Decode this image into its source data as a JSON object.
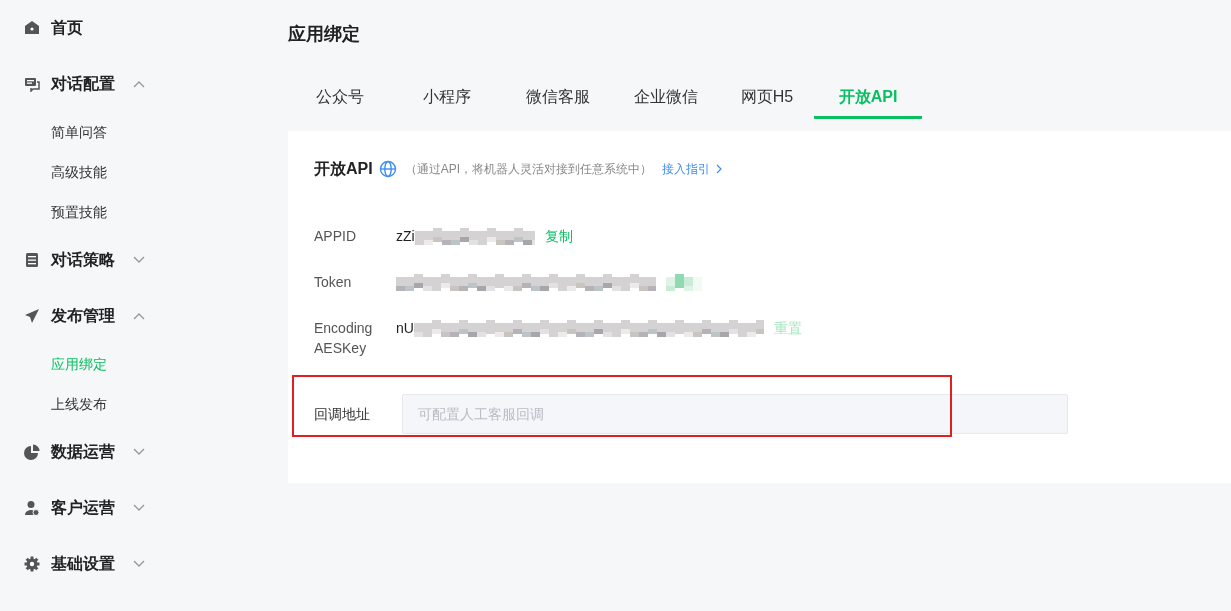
{
  "sidebar": {
    "items": [
      {
        "label": "首页"
      },
      {
        "label": "对话配置",
        "expanded": true,
        "children": [
          {
            "label": "简单问答",
            "selected": false
          },
          {
            "label": "高级技能",
            "selected": false
          },
          {
            "label": "预置技能",
            "selected": false
          }
        ]
      },
      {
        "label": "对话策略",
        "expanded": false
      },
      {
        "label": "发布管理",
        "expanded": true,
        "children": [
          {
            "label": "应用绑定",
            "selected": true
          },
          {
            "label": "上线发布",
            "selected": false
          }
        ]
      },
      {
        "label": "数据运营",
        "expanded": false
      },
      {
        "label": "客户运营",
        "expanded": false
      },
      {
        "label": "基础设置",
        "expanded": false
      }
    ]
  },
  "page_title": "应用绑定",
  "tabs": [
    {
      "label": "公众号",
      "selected": false
    },
    {
      "label": "小程序",
      "selected": false
    },
    {
      "label": "微信客服",
      "selected": false
    },
    {
      "label": "企业微信",
      "selected": false
    },
    {
      "label": "网页H5",
      "selected": false
    },
    {
      "label": "开放API",
      "selected": true
    }
  ],
  "card": {
    "title": "开放API",
    "hint": "（通过API，将机器人灵活对接到任意系统中）",
    "guide_link": "接入指引",
    "fields": [
      {
        "label": "APPID",
        "value": "zZi",
        "action": "复制"
      },
      {
        "label": "Token"
      },
      {
        "label": "Encoding AESKey",
        "value": "nU",
        "action": "重置"
      }
    ],
    "callback": {
      "label": "回调地址",
      "placeholder": "可配置人工客服回调",
      "highlighted": true
    }
  }
}
